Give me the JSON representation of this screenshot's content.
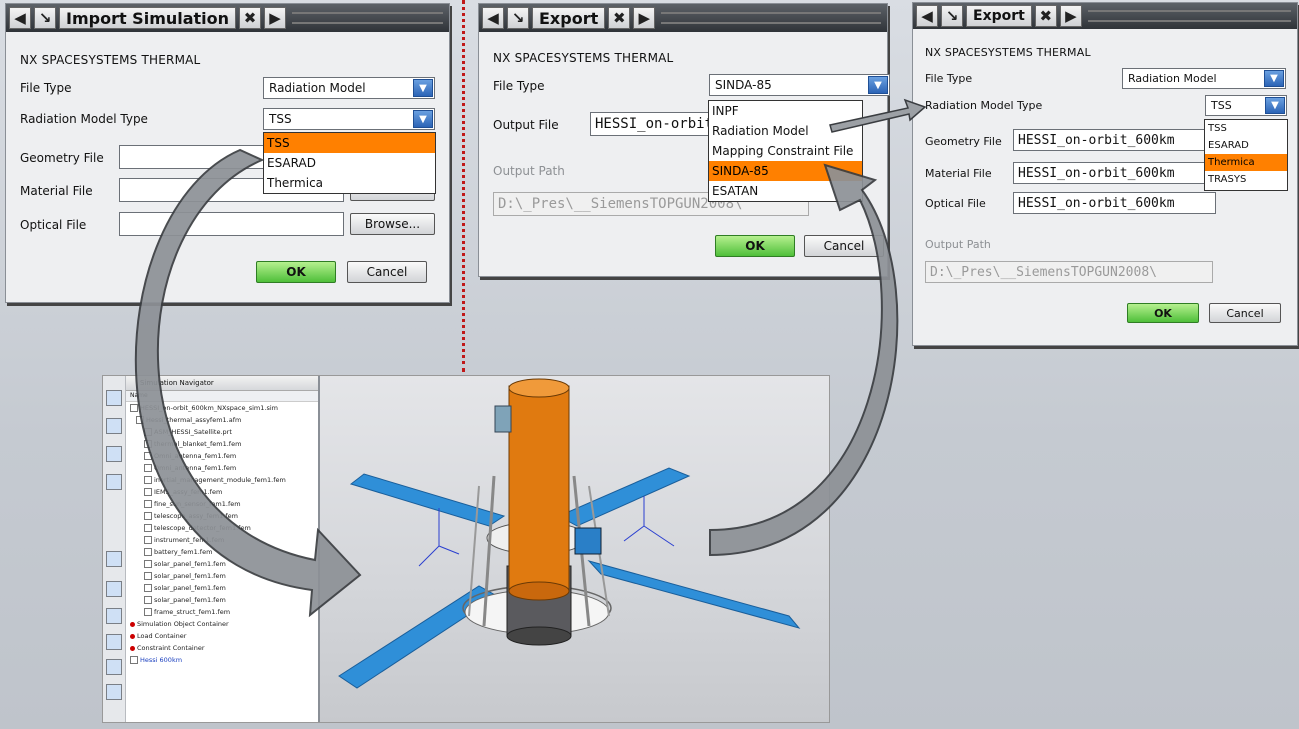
{
  "import_dialog": {
    "title": "Import Simulation",
    "header": "NX SPACESYSTEMS THERMAL",
    "file_type_label": "File Type",
    "file_type_value": "Radiation Model",
    "rad_type_label": "Radiation Model Type",
    "rad_type_value": "TSS",
    "dropdown_options": [
      "TSS",
      "ESARAD",
      "Thermica"
    ],
    "dropdown_selected": "TSS",
    "geometry_label": "Geometry File",
    "material_label": "Material File",
    "optical_label": "Optical File",
    "browse_label": "Browse...",
    "ok_label": "OK",
    "cancel_label": "Cancel"
  },
  "export_dialog_1": {
    "title": "Export",
    "header": "NX SPACESYSTEMS THERMAL",
    "file_type_label": "File Type",
    "file_type_value": "SINDA-85",
    "output_file_label": "Output File",
    "output_file_value": "HESSI_on-orbit_600km",
    "output_path_label": "Output Path",
    "output_path_value": "D:\\_Pres\\__SiemensTOPGUN2008\\",
    "dropdown_options": [
      "INPF",
      "Radiation Model",
      "Mapping Constraint File",
      "SINDA-85",
      "ESATAN"
    ],
    "dropdown_selected": "SINDA-85",
    "ok_label": "OK",
    "cancel_label": "Cancel"
  },
  "export_dialog_2": {
    "title": "Export",
    "header": "NX SPACESYSTEMS THERMAL",
    "file_type_label": "File Type",
    "file_type_value": "Radiation Model",
    "rad_type_label": "Radiation Model Type",
    "rad_type_value": "TSS",
    "dropdown_options": [
      "TSS",
      "ESARAD",
      "Thermica",
      "TRASYS"
    ],
    "dropdown_selected": "Thermica",
    "geometry_label": "Geometry File",
    "geometry_value": "HESSI_on-orbit_600km",
    "material_label": "Material File",
    "material_value": "HESSI_on-orbit_600km",
    "optical_label": "Optical File",
    "optical_value": "HESSI_on-orbit_600km",
    "output_path_label": "Output Path",
    "output_path_value": "D:\\_Pres\\__SiemensTOPGUN2008\\",
    "ok_label": "OK",
    "cancel_label": "Cancel"
  },
  "navigator": {
    "title": "Simulation Navigator",
    "column": "Name",
    "rows": [
      "HESSI_on-orbit_600km_NXspace_sim1.sim",
      "Hessi_thermal_assyfem1.afm",
      "ASM_HESSI_Satellite.prt",
      "thermal_blanket_fem1.fem",
      "Omni_antenna_fem1.fem",
      "Omni_antenna_fem1.fem",
      "inertial_management_module_fem1.fem",
      "IEMS_assy_fem1.fem",
      "fine_sun_sensor_fem1.fem",
      "telescope_assy_fem1.fem",
      "telescope_detector_fem1.fem",
      "instrument_fem1.fem",
      "battery_fem1.fem",
      "solar_panel_fem1.fem",
      "solar_panel_fem1.fem",
      "solar_panel_fem1.fem",
      "solar_panel_fem1.fem",
      "frame_struct_fem1.fem",
      "Simulation Object Container",
      "Load Container",
      "Constraint Container",
      "Hessi 600km"
    ]
  },
  "colors": {
    "accent_orange": "#ff8000",
    "ok_green": "#4fbf3a",
    "panel_blue": "#2f8fd8",
    "body_orange": "#e07a10"
  }
}
